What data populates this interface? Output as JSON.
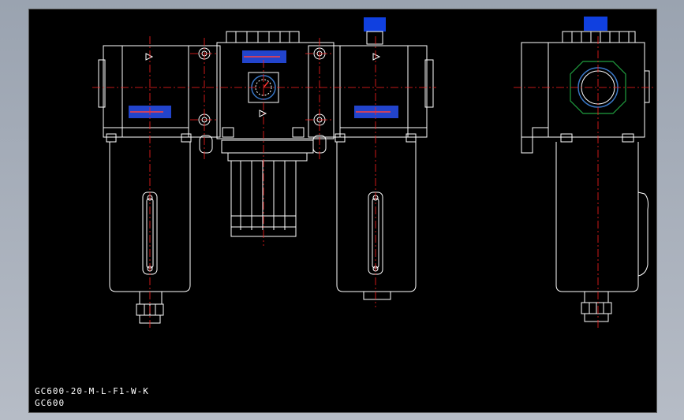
{
  "drawing": {
    "model_code": "GC600-20-M-L-F1-W-K",
    "series": "GC600"
  },
  "colors": {
    "background": "#000000",
    "outline": "#ffffff",
    "centerline": "#ff2020",
    "cap": "#1040e0",
    "label_panel": "#2244cc",
    "gauge_ring": "#3a78c8",
    "port_ring": "#20a040"
  }
}
